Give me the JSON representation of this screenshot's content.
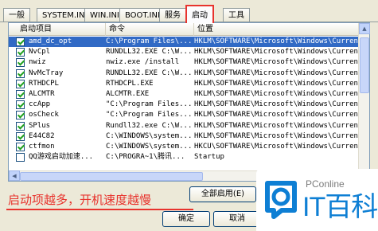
{
  "tabs": [
    "一般",
    "SYSTEM.INI",
    "WIN.INI",
    "BOOT.INI",
    "服务",
    "启动",
    "工具"
  ],
  "columns": [
    "启动项目",
    "命令",
    "位置"
  ],
  "rows": [
    {
      "name": "amd_dc_opt",
      "command": "C:\\Program Files\\...",
      "location": "HKLM\\SOFTWARE\\Microsoft\\Windows\\Current...",
      "checked": true,
      "selected": true
    },
    {
      "name": "NvCpl",
      "command": "RUNDLL32.EXE C:\\W...",
      "location": "HKLM\\SOFTWARE\\Microsoft\\Windows\\Current...",
      "checked": true,
      "selected": false
    },
    {
      "name": "nwiz",
      "command": "nwiz.exe /install",
      "location": "HKLM\\SOFTWARE\\Microsoft\\Windows\\Current...",
      "checked": true,
      "selected": false
    },
    {
      "name": "NvMcTray",
      "command": "RUNDLL32.EXE C:\\W...",
      "location": "HKLM\\SOFTWARE\\Microsoft\\Windows\\Current...",
      "checked": true,
      "selected": false
    },
    {
      "name": "RTHDCPL",
      "command": "RTHDCPL.EXE",
      "location": "HKLM\\SOFTWARE\\Microsoft\\Windows\\Current...",
      "checked": true,
      "selected": false
    },
    {
      "name": "ALCMTR",
      "command": "ALCMTR.EXE",
      "location": "HKLM\\SOFTWARE\\Microsoft\\Windows\\Current...",
      "checked": true,
      "selected": false
    },
    {
      "name": "ccApp",
      "command": "\"C:\\Program Files...",
      "location": "HKLM\\SOFTWARE\\Microsoft\\Windows\\Current...",
      "checked": true,
      "selected": false
    },
    {
      "name": "osCheck",
      "command": "\"C:\\Program Files...",
      "location": "HKLM\\SOFTWARE\\Microsoft\\Windows\\Current...",
      "checked": true,
      "selected": false
    },
    {
      "name": "SPlus",
      "command": "Rundll32.exe C:\\W...",
      "location": "HKLM\\SOFTWARE\\Microsoft\\Windows\\Current...",
      "checked": true,
      "selected": false
    },
    {
      "name": "E44C82",
      "command": "C:\\WINDOWS\\system...",
      "location": "HKLM\\SOFTWARE\\Microsoft\\Windows\\Current...",
      "checked": true,
      "selected": false
    },
    {
      "name": "ctfmon",
      "command": "C:\\WINDOWS\\system...",
      "location": "HKCU\\SOFTWARE\\Microsoft\\Windows\\Current...",
      "checked": true,
      "selected": false
    },
    {
      "name": "QQ游戏启动加速...",
      "command": "C:\\PROGRA~1\\腾讯...",
      "location": "Startup",
      "checked": false,
      "selected": false
    }
  ],
  "annotation": "启动项越多，开机速度越慢",
  "buttons": {
    "enable_all": "全部启用(E)",
    "ok": "确定",
    "cancel": "取消"
  },
  "brand": {
    "small": "PConline",
    "big": "IT百科"
  },
  "colors": {
    "highlight": "#e8332d",
    "selection": "#316ac5",
    "brand": "#0e7fd4"
  }
}
